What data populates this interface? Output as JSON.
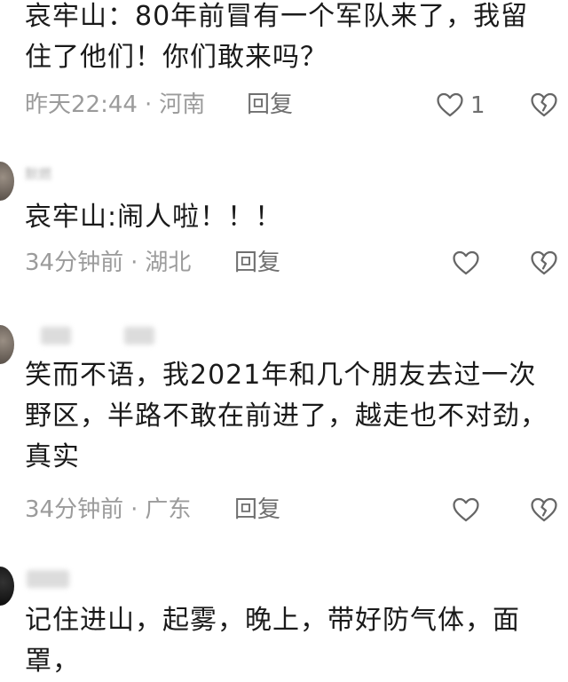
{
  "comments": [
    {
      "text": "哀牢山：80年前冒有一个军队来了，我留\n住了他们！你们敢来吗？",
      "time": "昨天22:44",
      "location": "河南",
      "reply_label": "回复",
      "like_count": "1"
    },
    {
      "username": "默燃",
      "text": "哀牢山:闹人啦！！！",
      "time": "34分钟前",
      "location": "湖北",
      "reply_label": "回复"
    },
    {
      "text": "笑而不语，我2021年和几个朋友去过一次\n野区，半路不敢在前进了，越走也不对劲，\n真实",
      "time": "34分钟前",
      "location": "广东",
      "reply_label": "回复"
    },
    {
      "text": "记住进山，起雾，晚上，带好防气体，面罩，",
      "time": "",
      "location": "",
      "reply_label": ""
    }
  ],
  "separator": "·",
  "icons": {
    "like": "heart-outline-icon",
    "dislike": "broken-heart-icon"
  },
  "colors": {
    "text": "#1a1a1a",
    "meta": "#9b9b9b",
    "icon": "#666666"
  }
}
